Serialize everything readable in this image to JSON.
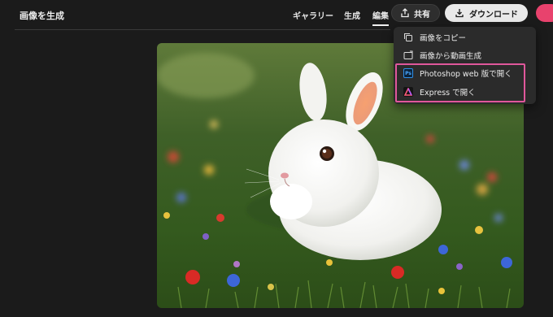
{
  "header": {
    "title": "画像を生成",
    "nav": {
      "gallery": "ギャラリー",
      "generate": "生成",
      "edit": "編集"
    },
    "share_label": "共有",
    "download_label": "ダウンロード"
  },
  "image": {
    "subject": "white rabbit in flower meadow"
  },
  "menu": {
    "items": [
      {
        "label": "画像をコピー",
        "icon": "copy-icon"
      },
      {
        "label": "画像から動画生成",
        "icon": "image-to-video-icon"
      },
      {
        "label": "Photoshop web 版で開く",
        "icon": "photoshop-icon",
        "badge": "Ps"
      },
      {
        "label": "Express で開く",
        "icon": "express-icon"
      }
    ]
  },
  "colors": {
    "background": "#1b1b1b",
    "menu_bg": "#2b2b2b",
    "highlight": "#e0579b",
    "download_bg": "#e9e9e9",
    "accent_pink": "#e8426d"
  }
}
